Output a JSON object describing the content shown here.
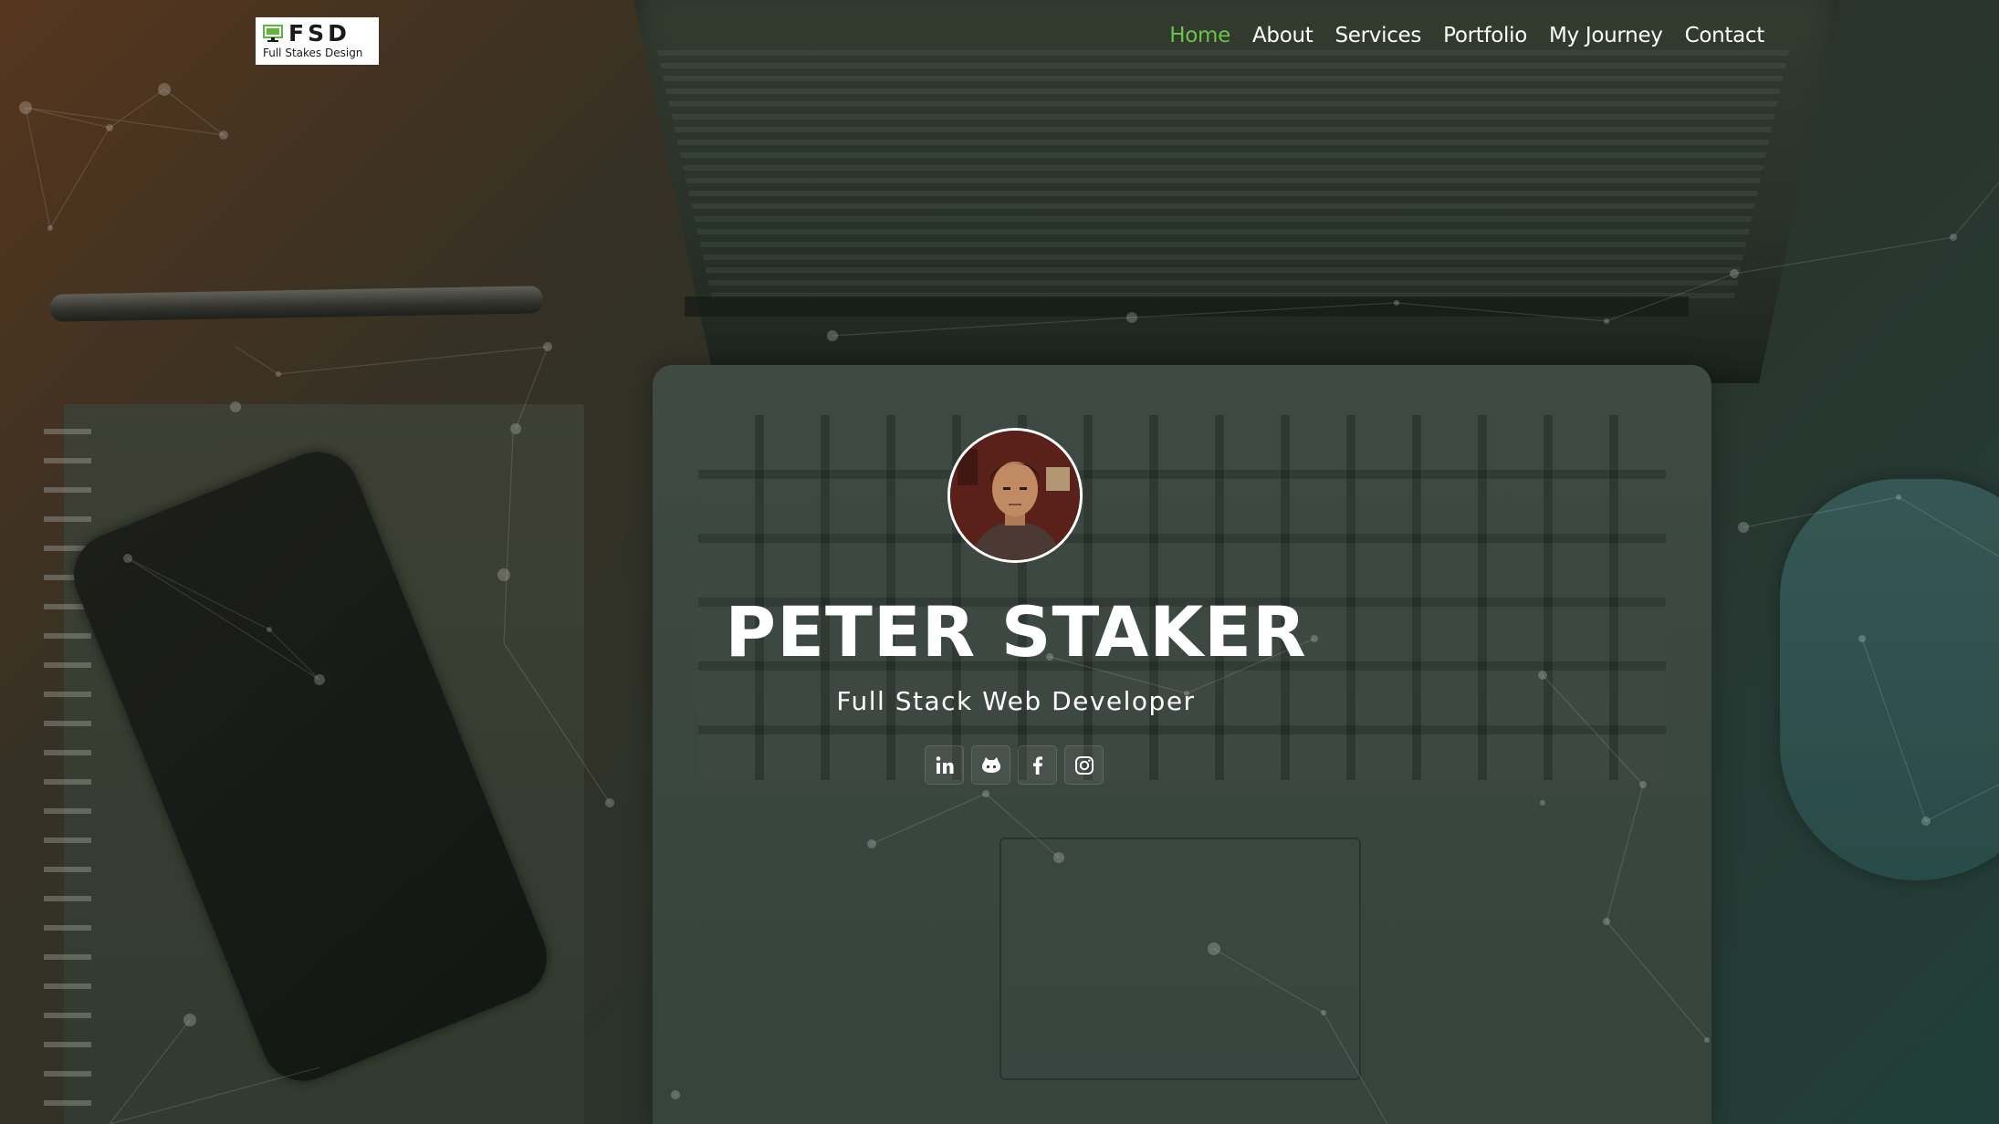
{
  "logo": {
    "mark": "FSD",
    "subtitle": "Full Stakes Design"
  },
  "nav": {
    "items": [
      {
        "label": "Home",
        "active": true
      },
      {
        "label": "About"
      },
      {
        "label": "Services"
      },
      {
        "label": "Portfolio"
      },
      {
        "label": "My Journey"
      },
      {
        "label": "Contact"
      }
    ],
    "active_color": "#6ac34a"
  },
  "hero": {
    "name": "PETER STAKER",
    "tagline": "Full Stack Web Developer"
  },
  "social": [
    {
      "icon": "linkedin-icon"
    },
    {
      "icon": "github-icon"
    },
    {
      "icon": "facebook-icon"
    },
    {
      "icon": "instagram-icon"
    }
  ]
}
